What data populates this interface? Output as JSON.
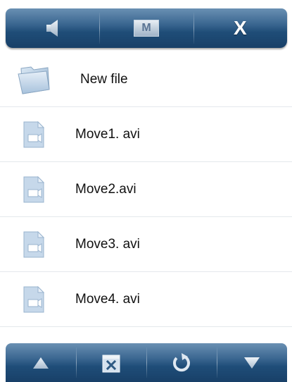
{
  "top_toolbar": {
    "mode_label": "M",
    "close_label": "X"
  },
  "files": [
    {
      "name": "New file",
      "kind": "folder"
    },
    {
      "name": "Move1. avi",
      "kind": "video"
    },
    {
      "name": "Move2.avi",
      "kind": "video"
    },
    {
      "name": "Move3. avi",
      "kind": "video"
    },
    {
      "name": "Move4. avi",
      "kind": "video"
    }
  ],
  "icons": {
    "top": [
      "speaker-icon",
      "mode-m-icon",
      "close-x-icon"
    ],
    "bottom": [
      "arrow-up-icon",
      "delete-file-icon",
      "refresh-icon",
      "arrow-down-icon"
    ]
  },
  "colors": {
    "toolbar_dark": "#1f4d78",
    "toolbar_light": "#6a90b3",
    "icon_light": "#c6d8ea",
    "row_divider": "#e4e8ec"
  }
}
